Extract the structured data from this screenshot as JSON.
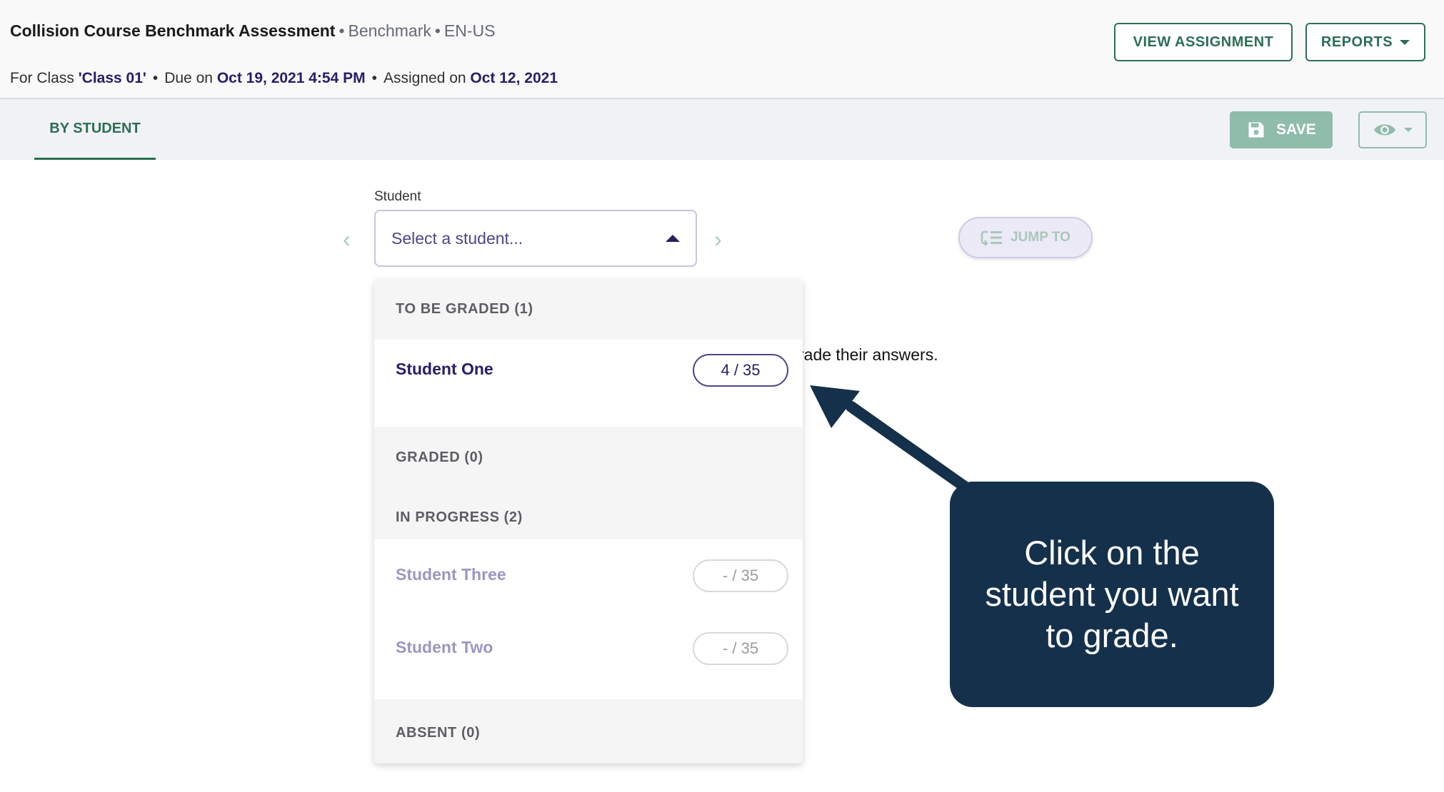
{
  "header": {
    "title": "Collision Course Benchmark Assessment",
    "type": "Benchmark",
    "locale": "EN-US",
    "class_prefix": "For Class ",
    "class_name": "'Class 01'",
    "due_prefix": "Due on ",
    "due_date": "Oct 19, 2021 4:54 PM",
    "assigned_prefix": "Assigned on ",
    "assigned_date": "Oct 12, 2021",
    "view_assignment_label": "VIEW ASSIGNMENT",
    "reports_label": "REPORTS"
  },
  "tabs": {
    "by_student_label": "BY STUDENT",
    "save_label": "SAVE"
  },
  "student_selector": {
    "label": "Student",
    "placeholder": "Select a student...",
    "jump_to_label": "JUMP TO"
  },
  "body_text": "rade their answers.",
  "dropdown": {
    "groups": [
      {
        "label": "TO BE GRADED (1)"
      },
      {
        "label": "GRADED (0)"
      },
      {
        "label": "IN PROGRESS (2)"
      },
      {
        "label": "ABSENT (0)"
      }
    ],
    "students": [
      {
        "name": "Student One",
        "score": "4 / 35"
      },
      {
        "name": "Student Three",
        "score": "- / 35"
      },
      {
        "name": "Student Two",
        "score": "- / 35"
      }
    ]
  },
  "callout": {
    "text": "Click on the student you want to grade."
  },
  "colors": {
    "accent_green": "#2c6e54",
    "navy": "#2a1d63",
    "callout_bg": "#15304a"
  }
}
